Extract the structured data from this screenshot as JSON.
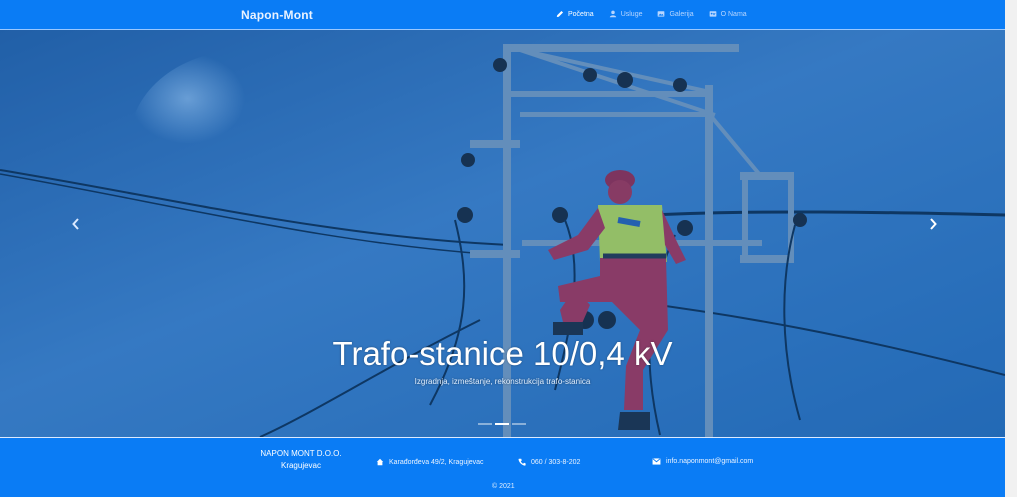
{
  "brand": "Napon-Mont",
  "nav": {
    "items": [
      {
        "label": "Početna",
        "icon": "pencil-icon",
        "active": true
      },
      {
        "label": "Usluge",
        "icon": "user-icon",
        "active": false
      },
      {
        "label": "Galerija",
        "icon": "gallery-icon",
        "active": false
      },
      {
        "label": "O Nama",
        "icon": "id-card-icon",
        "active": false
      }
    ]
  },
  "hero": {
    "title": "Trafo-stanice 10/0,4 kV",
    "subtitle": "Izgradnja, izmeštanje, rekonstrukcija trafo-stanica",
    "prev_icon": "chevron-left-icon",
    "next_icon": "chevron-right-icon",
    "slide_count": 3,
    "active_slide": 2
  },
  "footer": {
    "company_line1": "NAPON MONT D.O.O.",
    "company_line2": "Kragujevac",
    "address": "Karađorđeva 49/2, Kragujevac",
    "phone": "060 / 303-8-202",
    "email": "info.naponmont@gmail.com",
    "copyright": "© 2021"
  },
  "colors": {
    "primary": "#0a7cf5",
    "hero_tint": "#1062be",
    "text": "#ffffff"
  }
}
